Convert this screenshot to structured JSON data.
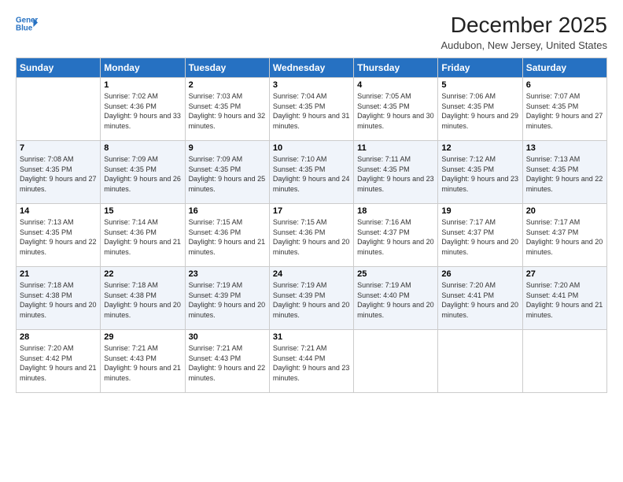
{
  "logo": {
    "line1": "General",
    "line2": "Blue",
    "icon": "▶"
  },
  "header": {
    "title": "December 2025",
    "subtitle": "Audubon, New Jersey, United States"
  },
  "days": [
    "Sunday",
    "Monday",
    "Tuesday",
    "Wednesday",
    "Thursday",
    "Friday",
    "Saturday"
  ],
  "weeks": [
    [
      {
        "day": "",
        "sunrise": "",
        "sunset": "",
        "daylight": ""
      },
      {
        "day": "1",
        "sunrise": "Sunrise: 7:02 AM",
        "sunset": "Sunset: 4:36 PM",
        "daylight": "Daylight: 9 hours and 33 minutes."
      },
      {
        "day": "2",
        "sunrise": "Sunrise: 7:03 AM",
        "sunset": "Sunset: 4:35 PM",
        "daylight": "Daylight: 9 hours and 32 minutes."
      },
      {
        "day": "3",
        "sunrise": "Sunrise: 7:04 AM",
        "sunset": "Sunset: 4:35 PM",
        "daylight": "Daylight: 9 hours and 31 minutes."
      },
      {
        "day": "4",
        "sunrise": "Sunrise: 7:05 AM",
        "sunset": "Sunset: 4:35 PM",
        "daylight": "Daylight: 9 hours and 30 minutes."
      },
      {
        "day": "5",
        "sunrise": "Sunrise: 7:06 AM",
        "sunset": "Sunset: 4:35 PM",
        "daylight": "Daylight: 9 hours and 29 minutes."
      },
      {
        "day": "6",
        "sunrise": "Sunrise: 7:07 AM",
        "sunset": "Sunset: 4:35 PM",
        "daylight": "Daylight: 9 hours and 27 minutes."
      }
    ],
    [
      {
        "day": "7",
        "sunrise": "Sunrise: 7:08 AM",
        "sunset": "Sunset: 4:35 PM",
        "daylight": "Daylight: 9 hours and 27 minutes."
      },
      {
        "day": "8",
        "sunrise": "Sunrise: 7:09 AM",
        "sunset": "Sunset: 4:35 PM",
        "daylight": "Daylight: 9 hours and 26 minutes."
      },
      {
        "day": "9",
        "sunrise": "Sunrise: 7:09 AM",
        "sunset": "Sunset: 4:35 PM",
        "daylight": "Daylight: 9 hours and 25 minutes."
      },
      {
        "day": "10",
        "sunrise": "Sunrise: 7:10 AM",
        "sunset": "Sunset: 4:35 PM",
        "daylight": "Daylight: 9 hours and 24 minutes."
      },
      {
        "day": "11",
        "sunrise": "Sunrise: 7:11 AM",
        "sunset": "Sunset: 4:35 PM",
        "daylight": "Daylight: 9 hours and 23 minutes."
      },
      {
        "day": "12",
        "sunrise": "Sunrise: 7:12 AM",
        "sunset": "Sunset: 4:35 PM",
        "daylight": "Daylight: 9 hours and 23 minutes."
      },
      {
        "day": "13",
        "sunrise": "Sunrise: 7:13 AM",
        "sunset": "Sunset: 4:35 PM",
        "daylight": "Daylight: 9 hours and 22 minutes."
      }
    ],
    [
      {
        "day": "14",
        "sunrise": "Sunrise: 7:13 AM",
        "sunset": "Sunset: 4:35 PM",
        "daylight": "Daylight: 9 hours and 22 minutes."
      },
      {
        "day": "15",
        "sunrise": "Sunrise: 7:14 AM",
        "sunset": "Sunset: 4:36 PM",
        "daylight": "Daylight: 9 hours and 21 minutes."
      },
      {
        "day": "16",
        "sunrise": "Sunrise: 7:15 AM",
        "sunset": "Sunset: 4:36 PM",
        "daylight": "Daylight: 9 hours and 21 minutes."
      },
      {
        "day": "17",
        "sunrise": "Sunrise: 7:15 AM",
        "sunset": "Sunset: 4:36 PM",
        "daylight": "Daylight: 9 hours and 20 minutes."
      },
      {
        "day": "18",
        "sunrise": "Sunrise: 7:16 AM",
        "sunset": "Sunset: 4:37 PM",
        "daylight": "Daylight: 9 hours and 20 minutes."
      },
      {
        "day": "19",
        "sunrise": "Sunrise: 7:17 AM",
        "sunset": "Sunset: 4:37 PM",
        "daylight": "Daylight: 9 hours and 20 minutes."
      },
      {
        "day": "20",
        "sunrise": "Sunrise: 7:17 AM",
        "sunset": "Sunset: 4:37 PM",
        "daylight": "Daylight: 9 hours and 20 minutes."
      }
    ],
    [
      {
        "day": "21",
        "sunrise": "Sunrise: 7:18 AM",
        "sunset": "Sunset: 4:38 PM",
        "daylight": "Daylight: 9 hours and 20 minutes."
      },
      {
        "day": "22",
        "sunrise": "Sunrise: 7:18 AM",
        "sunset": "Sunset: 4:38 PM",
        "daylight": "Daylight: 9 hours and 20 minutes."
      },
      {
        "day": "23",
        "sunrise": "Sunrise: 7:19 AM",
        "sunset": "Sunset: 4:39 PM",
        "daylight": "Daylight: 9 hours and 20 minutes."
      },
      {
        "day": "24",
        "sunrise": "Sunrise: 7:19 AM",
        "sunset": "Sunset: 4:39 PM",
        "daylight": "Daylight: 9 hours and 20 minutes."
      },
      {
        "day": "25",
        "sunrise": "Sunrise: 7:19 AM",
        "sunset": "Sunset: 4:40 PM",
        "daylight": "Daylight: 9 hours and 20 minutes."
      },
      {
        "day": "26",
        "sunrise": "Sunrise: 7:20 AM",
        "sunset": "Sunset: 4:41 PM",
        "daylight": "Daylight: 9 hours and 20 minutes."
      },
      {
        "day": "27",
        "sunrise": "Sunrise: 7:20 AM",
        "sunset": "Sunset: 4:41 PM",
        "daylight": "Daylight: 9 hours and 21 minutes."
      }
    ],
    [
      {
        "day": "28",
        "sunrise": "Sunrise: 7:20 AM",
        "sunset": "Sunset: 4:42 PM",
        "daylight": "Daylight: 9 hours and 21 minutes."
      },
      {
        "day": "29",
        "sunrise": "Sunrise: 7:21 AM",
        "sunset": "Sunset: 4:43 PM",
        "daylight": "Daylight: 9 hours and 21 minutes."
      },
      {
        "day": "30",
        "sunrise": "Sunrise: 7:21 AM",
        "sunset": "Sunset: 4:43 PM",
        "daylight": "Daylight: 9 hours and 22 minutes."
      },
      {
        "day": "31",
        "sunrise": "Sunrise: 7:21 AM",
        "sunset": "Sunset: 4:44 PM",
        "daylight": "Daylight: 9 hours and 23 minutes."
      },
      {
        "day": "",
        "sunrise": "",
        "sunset": "",
        "daylight": ""
      },
      {
        "day": "",
        "sunrise": "",
        "sunset": "",
        "daylight": ""
      },
      {
        "day": "",
        "sunrise": "",
        "sunset": "",
        "daylight": ""
      }
    ]
  ]
}
